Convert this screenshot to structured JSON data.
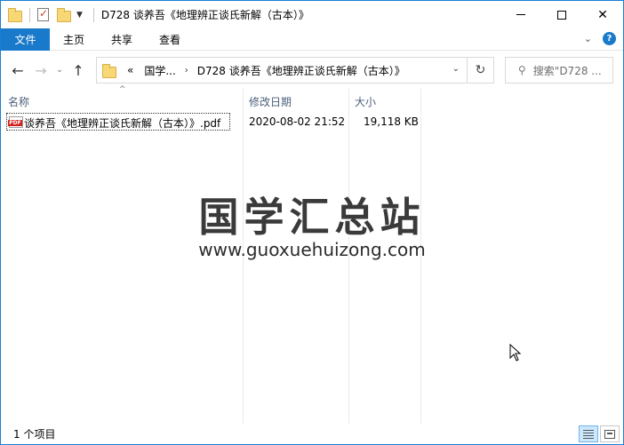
{
  "window": {
    "title": "D728 谈养吾《地理辨正谈氏新解（古本）》",
    "minimize_symbol": "",
    "close_symbol": "✕"
  },
  "ribbon": {
    "tabs": [
      "文件",
      "主页",
      "共享",
      "查看"
    ],
    "help_symbol": "?",
    "expand_symbol": "⌄"
  },
  "nav": {
    "back_symbol": "←",
    "forward_symbol": "→",
    "recent_symbol": "⌄",
    "up_symbol": "↑",
    "refresh_symbol": "↻"
  },
  "address": {
    "overflow": "«",
    "crumbs": [
      "国学...",
      "D728 谈养吾《地理辨正谈氏新解（古本）》"
    ],
    "separator": "›",
    "dropdown_symbol": "⌄"
  },
  "search": {
    "placeholder": "搜索\"D728 ...",
    "icon_symbol": "⚲"
  },
  "columns": {
    "name": "名称",
    "modified": "修改日期",
    "size": "大小",
    "sort_symbol": "^"
  },
  "files": [
    {
      "name": "谈养吾《地理辨正谈氏新解（古本）》.pdf",
      "modified": "2020-08-02 21:52",
      "size": "19,118 KB",
      "icon_label": "PDF"
    }
  ],
  "watermark": {
    "chinese": "国学汇总站",
    "url": "www.guoxuehuizong.com"
  },
  "status": {
    "item_count": "1 个项目"
  },
  "colors": {
    "accent": "#1979ca",
    "border": "#1c7fd4",
    "header_text": "#4c607a"
  }
}
